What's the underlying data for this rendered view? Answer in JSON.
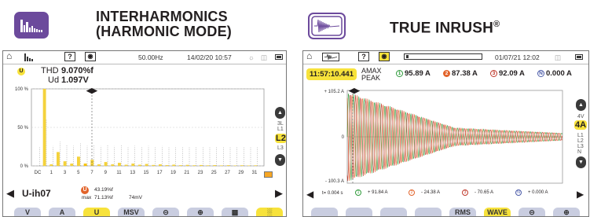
{
  "left": {
    "header": {
      "title_line1": "INTERHARMONICS",
      "title_line2": "(HARMONIC MODE)"
    },
    "status": {
      "frequency": "50.00Hz",
      "datetime": "14/02/20 10:57"
    },
    "readings": {
      "phase_label": "U",
      "thd_label": "THD",
      "thd_value": "9.070%f",
      "ud_label": "Ud",
      "ud_value": "1.097V"
    },
    "yaxis_ticks": [
      "100 %",
      "50 %",
      "0 %"
    ],
    "xaxis_ticks": [
      "DC",
      "1",
      "3",
      "5",
      "7",
      "9",
      "11",
      "13",
      "15",
      "17",
      "19",
      "21",
      "23",
      "25",
      "27",
      "29",
      "31"
    ],
    "side": {
      "top": "3L",
      "mid1": "L1",
      "selected": "L2",
      "mid2": "L3"
    },
    "footer": {
      "channel": "U-ih07",
      "badge": "U",
      "pct": "43.19%f",
      "max_label": "max",
      "max": "71.13%f",
      "mv": "74mV"
    },
    "softkeys": [
      "V",
      "A",
      "U",
      "MSV",
      "",
      "",
      "",
      ""
    ],
    "colors": {
      "accent": "#f7e23b",
      "brand": "#6c4a9c",
      "bar_orange": "#e8b010"
    }
  },
  "right": {
    "header": {
      "title": "TRUE INRUSH",
      "reg": "®"
    },
    "status": {
      "datetime": "01/07/21 12:02"
    },
    "time_pill": "11:57:10.441",
    "amax_label": "AMAX",
    "peak_label": "PEAK",
    "peaks": [
      {
        "num": "1",
        "value": "95.89 A",
        "color": "#2e9a3a",
        "filled": false
      },
      {
        "num": "2",
        "value": "87.38 A",
        "color": "#e2632a",
        "filled": true
      },
      {
        "num": "3",
        "value": "92.09 A",
        "color": "#c0392b",
        "filled": false
      },
      {
        "num": "N",
        "value": "0.000 A",
        "color": "#4a5aa8",
        "filled": false
      }
    ],
    "yaxis_ticks": [
      "+ 105.2 A",
      "0",
      "- 100.3 A"
    ],
    "side": {
      "top": "4V",
      "selected": "4A",
      "l1": "L1",
      "l2": "L2",
      "l3": "L3",
      "n": "N"
    },
    "footer": {
      "time": "t= 0.004 s",
      "vals": [
        {
          "num": "1",
          "value": "+ 91.84 A",
          "color": "#2e9a3a"
        },
        {
          "num": "2",
          "value": "- 24.38 A",
          "color": "#e2632a"
        },
        {
          "num": "3",
          "value": "- 70.65 A",
          "color": "#c0392b"
        },
        {
          "num": "N",
          "value": "+ 0.000 A",
          "color": "#4a5aa8"
        }
      ]
    },
    "softkeys": [
      "",
      "",
      "",
      "",
      "RMS",
      "WAVE",
      "",
      ""
    ]
  }
}
